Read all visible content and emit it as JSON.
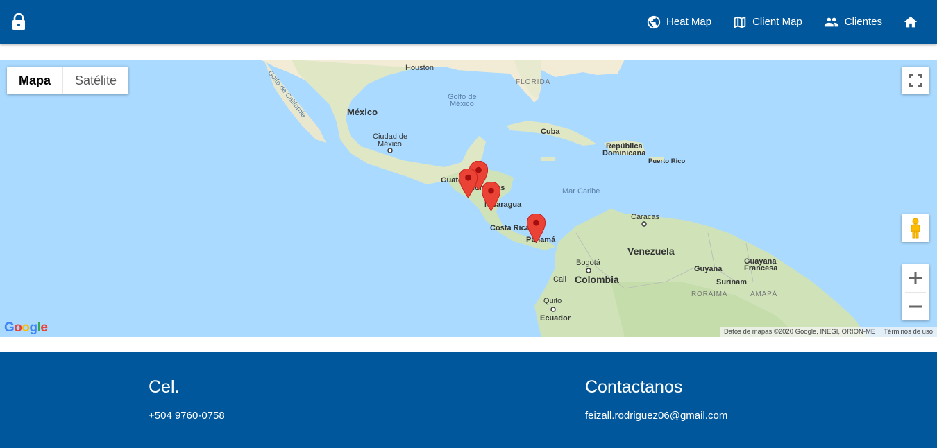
{
  "header": {
    "nav": [
      {
        "label": "Heat Map",
        "icon": "globe-icon"
      },
      {
        "label": "Client Map",
        "icon": "map-icon"
      },
      {
        "label": "Clientes",
        "icon": "people-icon"
      },
      {
        "label": "",
        "icon": "home-icon"
      }
    ],
    "left_icon": "lock-icon",
    "color": "#01579b"
  },
  "map": {
    "type_buttons": [
      "Mapa",
      "Satélite"
    ],
    "active_type": "Mapa",
    "labels": {
      "houston": "Houston",
      "gulf_ca": "Golfo de California",
      "gulf_mx_1": "Golfo de",
      "gulf_mx_2": "México",
      "florida": "FLORIDA",
      "mexico": "México",
      "cdmx_1": "Ciudad de",
      "cdmx_2": "México",
      "cuba": "Cuba",
      "rd_1": "República",
      "rd_2": "Dominicana",
      "pr": "Puerto Rico",
      "guatemala": "Guatemala",
      "honduras": "Honduras",
      "nicaragua": "Nicaragua",
      "mar_caribe": "Mar Caribe",
      "costa_rica": "Costa Rica",
      "panama": "Panamá",
      "caracas": "Caracas",
      "venezuela": "Venezuela",
      "bogota": "Bogotá",
      "guyana": "Guyana",
      "guayana_fr_1": "Guayana",
      "guayana_fr_2": "Francesa",
      "cali": "Cali",
      "colombia": "Colombia",
      "surinam": "Surinam",
      "roraima": "RORAIMA",
      "amapa": "AMAPÁ",
      "quito": "Quito",
      "ecuador": "Ecuador"
    },
    "attribution": "Datos de mapas ©2020 Google, INEGI, ORION-ME",
    "terms": "Términos de uso",
    "logo": "Google",
    "marker_color": "#ea4335"
  },
  "footer": {
    "col1_title": "Cel.",
    "col1_text": "+504 9760-0758",
    "col2_title": "Contactanos",
    "col2_text": "feizall.rodriguez06@gmail.com",
    "color": "#01579b"
  }
}
